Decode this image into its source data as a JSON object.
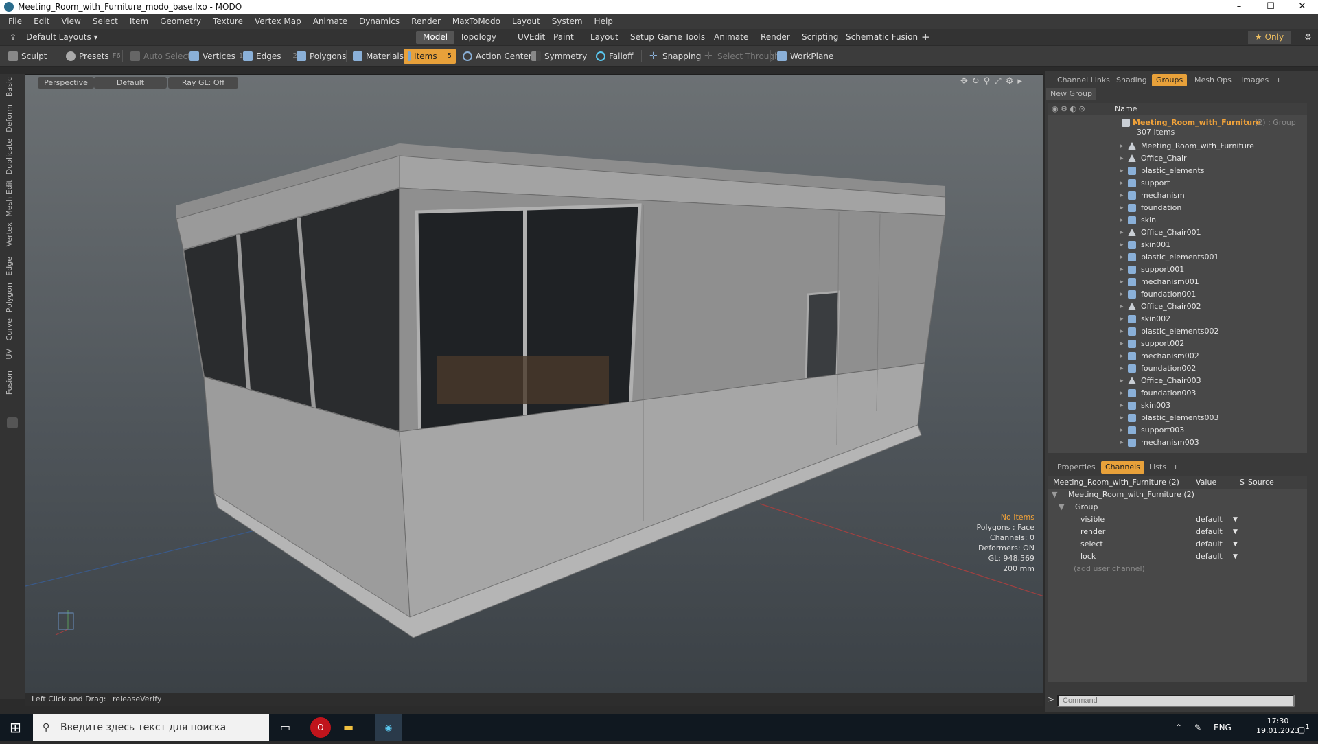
{
  "window": {
    "title": "Meeting_Room_with_Furniture_modo_base.lxo - MODO",
    "minimize": "–",
    "maximize": "☐",
    "close": "✕"
  },
  "menu": [
    "File",
    "Edit",
    "View",
    "Select",
    "Item",
    "Geometry",
    "Texture",
    "Vertex Map",
    "Animate",
    "Dynamics",
    "Render",
    "MaxToModo",
    "Layout",
    "System",
    "Help"
  ],
  "layoutbar": {
    "default_layouts": "Default Layouts ▾",
    "tabs": [
      "Model",
      "Topology",
      "UVEdit",
      "Paint",
      "Layout",
      "Setup",
      "Game Tools",
      "Animate",
      "Render",
      "Scripting",
      "Schematic Fusion"
    ],
    "active_tab": "Model",
    "add": "+",
    "only": "★ Only",
    "gear": "⚙"
  },
  "toolbar": {
    "sculpt": "Sculpt",
    "presets": "Presets",
    "presets_key": "F6",
    "auto_select": "Auto Select",
    "vertices": "Vertices",
    "vertices_count": "1",
    "edges": "Edges",
    "edges_count": "2",
    "polygons": "Polygons",
    "materials": "Materials",
    "items": "Items",
    "items_count": "5",
    "action_center": "Action Center",
    "symmetry": "Symmetry",
    "falloff": "Falloff",
    "snapping": "Snapping",
    "select_through": "Select Through",
    "workplane": "WorkPlane"
  },
  "left_tabs": [
    "Basic",
    "Deform",
    "Duplicate",
    "Mesh Edit",
    "Vertex",
    "Edge",
    "Polygon",
    "Curve",
    "UV",
    "Fusion"
  ],
  "viewport": {
    "view": "Perspective",
    "shading": "Default",
    "raygl": "Ray GL: Off",
    "info": [
      "No Items",
      "Polygons : Face",
      "Channels: 0",
      "Deformers: ON",
      "GL: 948,569",
      "200 mm"
    ]
  },
  "status": {
    "hint_label": "Left Click and Drag:",
    "hint_value": "releaseVerify"
  },
  "right_tabs": [
    "Channel Links",
    "Shading",
    "Groups",
    "Mesh Ops",
    "Images",
    "+"
  ],
  "right_active": "Groups",
  "groups": {
    "new_group": "New Group",
    "col_name": "Name",
    "root": {
      "name": "Meeting_Room_with_Furniture",
      "suffix": "(2) : Group",
      "count": "307 Items"
    },
    "items": [
      {
        "name": "Meeting_Room_with_Furniture",
        "kind": "locator"
      },
      {
        "name": "Office_Chair",
        "kind": "locator"
      },
      {
        "name": "plastic_elements",
        "kind": "mesh"
      },
      {
        "name": "support",
        "kind": "mesh"
      },
      {
        "name": "mechanism",
        "kind": "mesh"
      },
      {
        "name": "foundation",
        "kind": "mesh"
      },
      {
        "name": "skin",
        "kind": "mesh"
      },
      {
        "name": "Office_Chair001",
        "kind": "locator"
      },
      {
        "name": "skin001",
        "kind": "mesh"
      },
      {
        "name": "plastic_elements001",
        "kind": "mesh"
      },
      {
        "name": "support001",
        "kind": "mesh"
      },
      {
        "name": "mechanism001",
        "kind": "mesh"
      },
      {
        "name": "foundation001",
        "kind": "mesh"
      },
      {
        "name": "Office_Chair002",
        "kind": "locator"
      },
      {
        "name": "skin002",
        "kind": "mesh"
      },
      {
        "name": "plastic_elements002",
        "kind": "mesh"
      },
      {
        "name": "support002",
        "kind": "mesh"
      },
      {
        "name": "mechanism002",
        "kind": "mesh"
      },
      {
        "name": "foundation002",
        "kind": "mesh"
      },
      {
        "name": "Office_Chair003",
        "kind": "locator"
      },
      {
        "name": "foundation003",
        "kind": "mesh"
      },
      {
        "name": "skin003",
        "kind": "mesh"
      },
      {
        "name": "plastic_elements003",
        "kind": "mesh"
      },
      {
        "name": "support003",
        "kind": "mesh"
      },
      {
        "name": "mechanism003",
        "kind": "mesh"
      }
    ]
  },
  "props_tabs": [
    "Properties",
    "Channels",
    "Lists",
    "+"
  ],
  "props_active": "Channels",
  "channels": {
    "header": "Meeting_Room_with_Furniture (2)",
    "col_value": "Value",
    "col_s": "S",
    "col_source": "Source",
    "item": "Meeting_Room_with_Furniture (2)",
    "group": "Group",
    "rows": [
      {
        "name": "visible",
        "value": "default"
      },
      {
        "name": "render",
        "value": "default"
      },
      {
        "name": "select",
        "value": "default"
      },
      {
        "name": "lock",
        "value": "default"
      }
    ],
    "add_user": "(add user channel)"
  },
  "command": {
    "prompt": ">",
    "placeholder": "Command"
  },
  "taskbar": {
    "search": "Введите здесь текст для поиска",
    "lang": "ENG",
    "time": "17:30",
    "date": "19.01.2023",
    "notifications": "1"
  },
  "colors": {
    "accent": "#e8a13a",
    "orange_text": "#f0a23a"
  }
}
